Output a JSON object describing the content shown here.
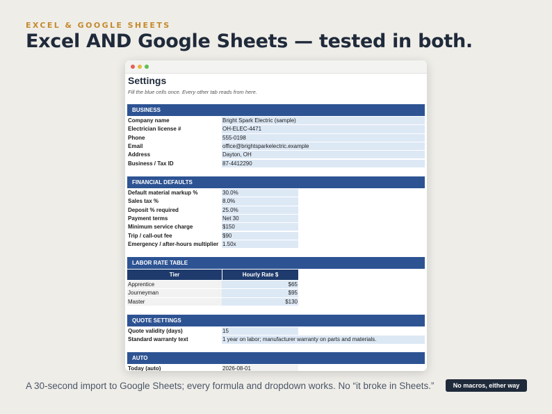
{
  "eyebrow": "EXCEL & GOOGLE SHEETS",
  "headline": "Excel AND Google Sheets — tested in both.",
  "sheet": {
    "title": "Settings",
    "subtitle": "Fill the blue cells once. Every other tab reads from here.",
    "business": {
      "header": "BUSINESS",
      "rows": [
        {
          "label": "Company name",
          "value": "Bright Spark Electric (sample)"
        },
        {
          "label": "Electrician license #",
          "value": "OH-ELEC-4471"
        },
        {
          "label": "Phone",
          "value": "555-0198"
        },
        {
          "label": "Email",
          "value": "office@brightsparkelectric.example"
        },
        {
          "label": "Address",
          "value": "Dayton, OH"
        },
        {
          "label": "Business / Tax ID",
          "value": "87-4412290"
        }
      ]
    },
    "financial": {
      "header": "FINANCIAL DEFAULTS",
      "rows": [
        {
          "label": "Default material markup %",
          "value": "30.0%"
        },
        {
          "label": "Sales tax %",
          "value": "8.0%"
        },
        {
          "label": "Deposit % required",
          "value": "25.0%"
        },
        {
          "label": "Payment terms",
          "value": "Net 30"
        },
        {
          "label": "Minimum service charge",
          "value": "$150"
        },
        {
          "label": "Trip / call-out fee",
          "value": "$90"
        },
        {
          "label": "Emergency / after-hours multiplier",
          "value": "1.50x"
        }
      ]
    },
    "labor": {
      "header": "LABOR RATE TABLE",
      "col_tier": "Tier",
      "col_rate": "Hourly Rate $",
      "rows": [
        {
          "tier": "Apprentice",
          "rate": "$65"
        },
        {
          "tier": "Journeyman",
          "rate": "$95"
        },
        {
          "tier": "Master",
          "rate": "$130"
        }
      ]
    },
    "quote": {
      "header": "QUOTE SETTINGS",
      "rows": [
        {
          "label": "Quote validity (days)",
          "value": "15"
        },
        {
          "label": "Standard warranty text",
          "value": "1 year on labor; manufacturer warranty on parts and materials."
        }
      ]
    },
    "auto": {
      "header": "AUTO",
      "rows": [
        {
          "label": "Today (auto)",
          "value": "2026-08-01"
        }
      ]
    }
  },
  "caption": "A 30-second import to Google Sheets; every formula and dropdown works. No “it broke in Sheets.”",
  "badge": "No macros, either way"
}
